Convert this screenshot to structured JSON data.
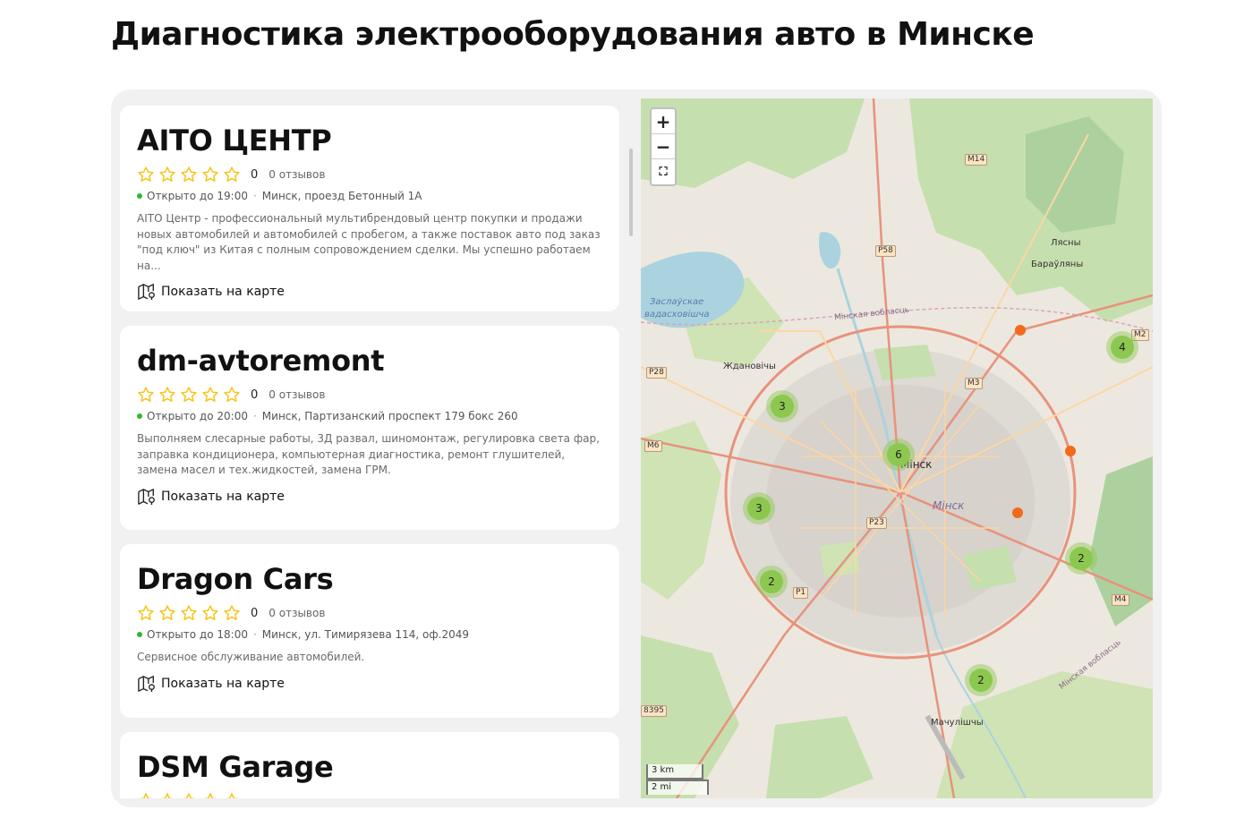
{
  "page": {
    "title": "Диагностика электрооборудования авто в Минске"
  },
  "cards": [
    {
      "title": "AITO ЦЕНТР",
      "rating": "0",
      "reviews": "0 отзывов",
      "status": "Открыто до 19:00",
      "address": "Минск, проезд Бетонный 1А",
      "description": "AITO Центр - профессиональный мультибрендовый центр покупки и продажи новых автомобилей и автомобилей с пробегом, а также поставок авто под заказ \"под ключ\" из Китая с полным сопровождением сделки. Мы успешно работаем на...",
      "map_link": "Показать на карте"
    },
    {
      "title": "dm-avtoremont",
      "rating": "0",
      "reviews": "0 отзывов",
      "status": "Открыто до 20:00",
      "address": "Минск, Партизанский проспект 179 бокс 260",
      "description": "Выполняем слесарные работы, 3Д развал, шиномонтаж, регулировка света фар, заправка кондиционера, компьютерная диагностика, ремонт глушителей, замена масел и тех.жидкостей, замена ГРМ.",
      "map_link": "Показать на карте"
    },
    {
      "title": "Dragon Cars",
      "rating": "0",
      "reviews": "0 отзывов",
      "status": "Открыто до 18:00",
      "address": "Минск, ул. Тимирязева 114, оф.2049",
      "description": "Сервисное обслуживание автомобилей.",
      "map_link": "Показать на карте"
    },
    {
      "title": "DSM Garage"
    }
  ],
  "map": {
    "zoom_in": "+",
    "zoom_out": "−",
    "fullscreen": "⛶",
    "clusters": [
      "3",
      "6",
      "3",
      "2",
      "2",
      "2",
      "4"
    ],
    "labels": {
      "water1": "Заслаўскае",
      "water2": "вадасховішча",
      "region1": "Мінская вобласць",
      "region2": "Мінская вобласць",
      "zhdanovichy": "Ждановічы",
      "lyasny": "Лясны",
      "barauliany": "Бараўляны",
      "minsk": "Мінск",
      "minsk_i": "Мінск",
      "machulishchy": "Мачулішчы"
    },
    "roads": [
      "M14",
      "P58",
      "P28",
      "M3",
      "M6",
      "P23",
      "P1",
      "M4",
      "M2",
      "8395"
    ],
    "scale_km": "3 km",
    "scale_mi": "2 mi"
  },
  "colors": {
    "star": "#f5c518",
    "open_dot": "#2eb82e",
    "cluster": "#8cc850",
    "pin": "#f26a1b"
  }
}
